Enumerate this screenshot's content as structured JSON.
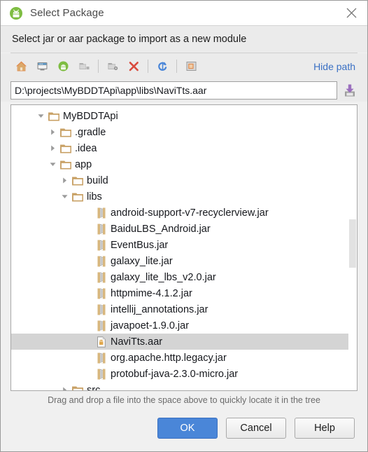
{
  "window": {
    "title": "Select Package",
    "app_icon": "android-studio-icon",
    "close_label": "Close"
  },
  "subtitle": "Select jar or aar package to import as a new module",
  "toolbar": {
    "buttons": [
      {
        "name": "home-icon",
        "tooltip": "Home"
      },
      {
        "name": "desktop-icon",
        "tooltip": "Desktop"
      },
      {
        "name": "project-icon",
        "tooltip": "Project"
      },
      {
        "name": "folder-icon",
        "tooltip": "Module Directory"
      },
      {
        "name": "new-folder-icon",
        "tooltip": "New Folder"
      },
      {
        "name": "delete-icon",
        "tooltip": "Delete"
      },
      {
        "name": "refresh-icon",
        "tooltip": "Refresh"
      },
      {
        "name": "show-hidden-icon",
        "tooltip": "Show Hidden Files"
      }
    ],
    "hide_path_label": "Hide path"
  },
  "path_field": {
    "value": "D:\\projects\\MyBDDTApi\\app\\libs\\NaviTts.aar",
    "placeholder": "",
    "save_icon": "save-icon"
  },
  "tree": {
    "rows": [
      {
        "label": "MyBDDTApi",
        "indent": 2,
        "twisty": "down",
        "icon": "folder-icon",
        "selected": false
      },
      {
        "label": ".gradle",
        "indent": 3,
        "twisty": "right",
        "icon": "folder-icon",
        "selected": false
      },
      {
        "label": ".idea",
        "indent": 3,
        "twisty": "right",
        "icon": "folder-icon",
        "selected": false
      },
      {
        "label": "app",
        "indent": 3,
        "twisty": "down",
        "icon": "folder-icon",
        "selected": false
      },
      {
        "label": "build",
        "indent": 4,
        "twisty": "right",
        "icon": "folder-icon",
        "selected": false
      },
      {
        "label": "libs",
        "indent": 4,
        "twisty": "down",
        "icon": "folder-icon",
        "selected": false
      },
      {
        "label": "android-support-v7-recyclerview.jar",
        "indent": 6,
        "twisty": "none",
        "icon": "jar-icon",
        "selected": false
      },
      {
        "label": "BaiduLBS_Android.jar",
        "indent": 6,
        "twisty": "none",
        "icon": "jar-icon",
        "selected": false
      },
      {
        "label": "EventBus.jar",
        "indent": 6,
        "twisty": "none",
        "icon": "jar-icon",
        "selected": false
      },
      {
        "label": "galaxy_lite.jar",
        "indent": 6,
        "twisty": "none",
        "icon": "jar-icon",
        "selected": false
      },
      {
        "label": "galaxy_lite_lbs_v2.0.jar",
        "indent": 6,
        "twisty": "none",
        "icon": "jar-icon",
        "selected": false
      },
      {
        "label": "httpmime-4.1.2.jar",
        "indent": 6,
        "twisty": "none",
        "icon": "jar-icon",
        "selected": false
      },
      {
        "label": "intellij_annotations.jar",
        "indent": 6,
        "twisty": "none",
        "icon": "jar-icon",
        "selected": false
      },
      {
        "label": "javapoet-1.9.0.jar",
        "indent": 6,
        "twisty": "none",
        "icon": "jar-icon",
        "selected": false
      },
      {
        "label": "NaviTts.aar",
        "indent": 6,
        "twisty": "none",
        "icon": "aar-icon",
        "selected": true
      },
      {
        "label": "org.apache.http.legacy.jar",
        "indent": 6,
        "twisty": "none",
        "icon": "jar-icon",
        "selected": false
      },
      {
        "label": "protobuf-java-2.3.0-micro.jar",
        "indent": 6,
        "twisty": "none",
        "icon": "jar-icon",
        "selected": false
      },
      {
        "label": "src",
        "indent": 4,
        "twisty": "right",
        "icon": "folder-icon",
        "selected": false
      }
    ],
    "scrollbar": {
      "thumb_top_pct": 40,
      "thumb_height_pct": 17
    }
  },
  "hint": "Drag and drop a file into the space above to quickly locate it in the tree",
  "buttons": {
    "ok": "OK",
    "cancel": "Cancel",
    "help": "Help"
  },
  "colors": {
    "accent": "#4a86d8",
    "link": "#3a70c4",
    "folder": "#c8a064",
    "selection": "#d4d4d4",
    "dialog_bg": "#f0f0f0",
    "header_bg": "#ebebeb"
  }
}
